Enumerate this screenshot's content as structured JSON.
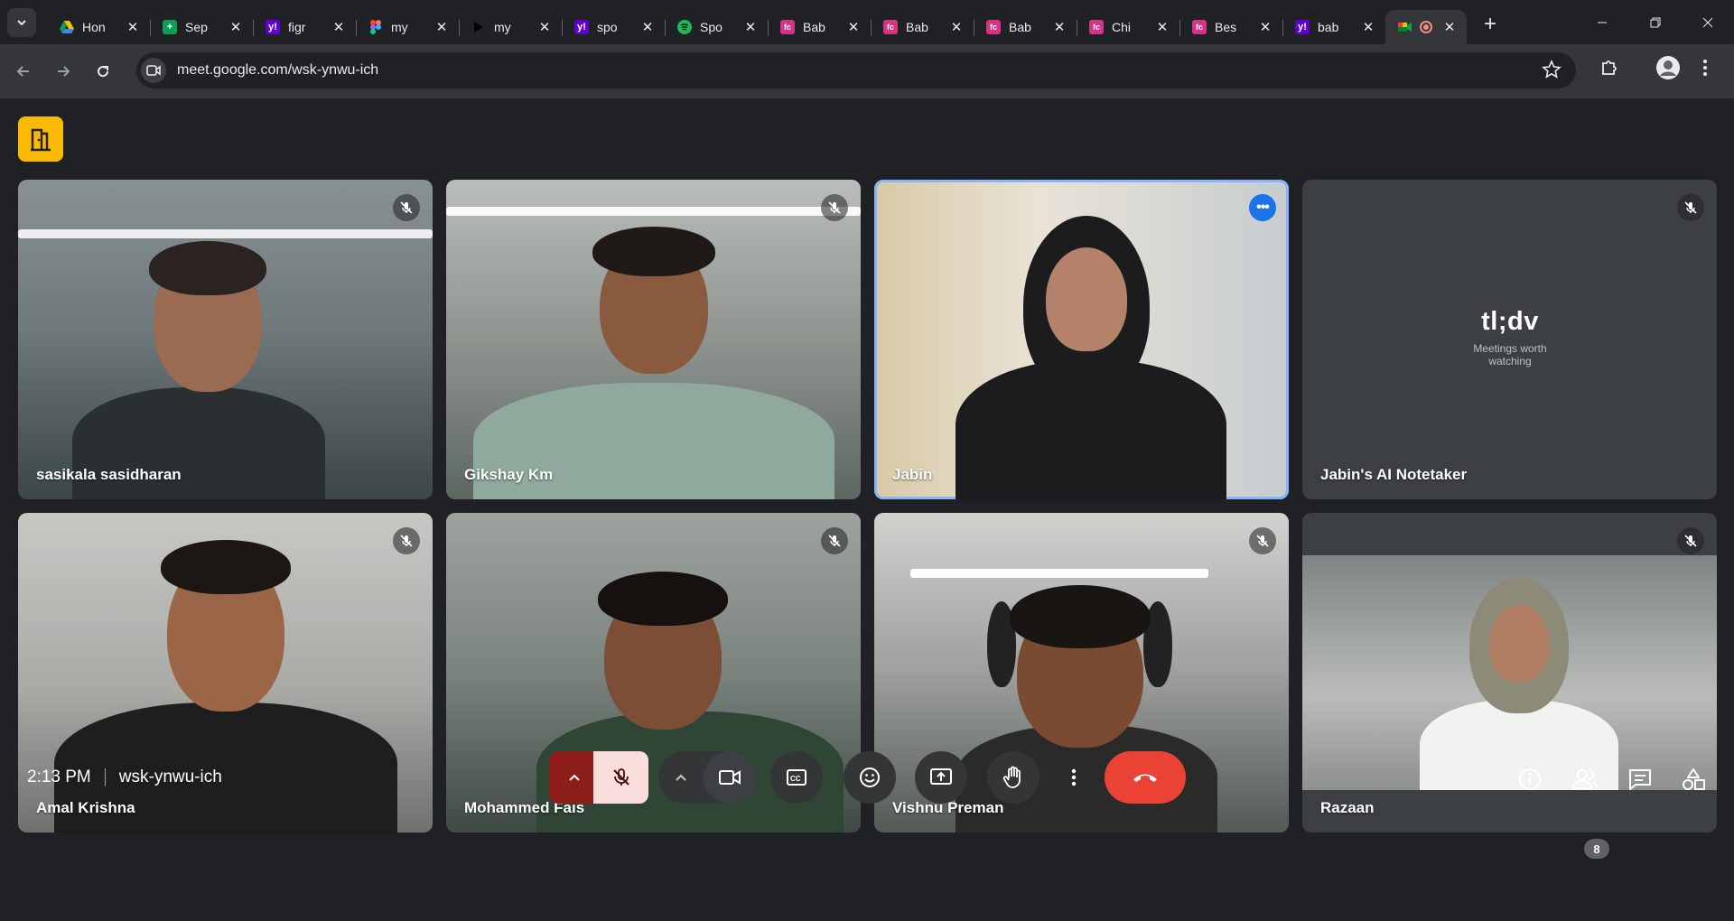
{
  "browser": {
    "tabs": [
      {
        "title": "Hon",
        "favicon": "google-drive-icon",
        "color": "#1a73e8"
      },
      {
        "title": "Sep",
        "favicon": "google-sheets-icon",
        "color": "#0f9d58"
      },
      {
        "title": "figr",
        "favicon": "yahoo-icon",
        "color": "#6001d2"
      },
      {
        "title": "my",
        "favicon": "figma-icon",
        "color": "#f24e1e"
      },
      {
        "title": "my",
        "favicon": "play-icon",
        "color": "#202124"
      },
      {
        "title": "spo",
        "favicon": "yahoo-icon",
        "color": "#6001d2"
      },
      {
        "title": "Spo",
        "favicon": "spotify-icon",
        "color": "#1db954"
      },
      {
        "title": "Bab",
        "favicon": "firstcry-icon",
        "color": "#d63384"
      },
      {
        "title": "Bab",
        "favicon": "firstcry-icon",
        "color": "#d63384"
      },
      {
        "title": "Bab",
        "favicon": "firstcry-icon",
        "color": "#d63384"
      },
      {
        "title": "Chi",
        "favicon": "firstcry-icon",
        "color": "#d63384"
      },
      {
        "title": "Bes",
        "favicon": "firstcry-icon",
        "color": "#d63384"
      },
      {
        "title": "bab",
        "favicon": "yahoo-icon",
        "color": "#6001d2"
      },
      {
        "title": "",
        "favicon": "google-meet-icon",
        "color": "#00897b",
        "active": true
      }
    ],
    "url": "meet.google.com/wsk-ynwu-ich"
  },
  "meeting": {
    "time": "2:13 PM",
    "code": "wsk-ynwu-ich",
    "participant_count": "8",
    "participants": [
      {
        "name": "sasikala sasidharan",
        "muted": true
      },
      {
        "name": "Gikshay Km",
        "muted": true
      },
      {
        "name": "Jabin",
        "muted": false,
        "active_speaker": true
      },
      {
        "name": "Jabin's AI Notetaker",
        "muted": true
      },
      {
        "name": "Amal Krishna",
        "muted": true
      },
      {
        "name": "Mohammed Fais",
        "muted": true
      },
      {
        "name": "Vishnu Preman",
        "muted": true
      },
      {
        "name": "Razaan",
        "muted": true
      }
    ],
    "notetaker": {
      "logo": "tl;dv",
      "tagline": "Meetings worth watching"
    }
  },
  "colors": {
    "accent": "#8ab4f8",
    "hangup": "#ea4335",
    "mic_off_bg": "#f9dedc",
    "logo_button": "#f9ba00"
  }
}
